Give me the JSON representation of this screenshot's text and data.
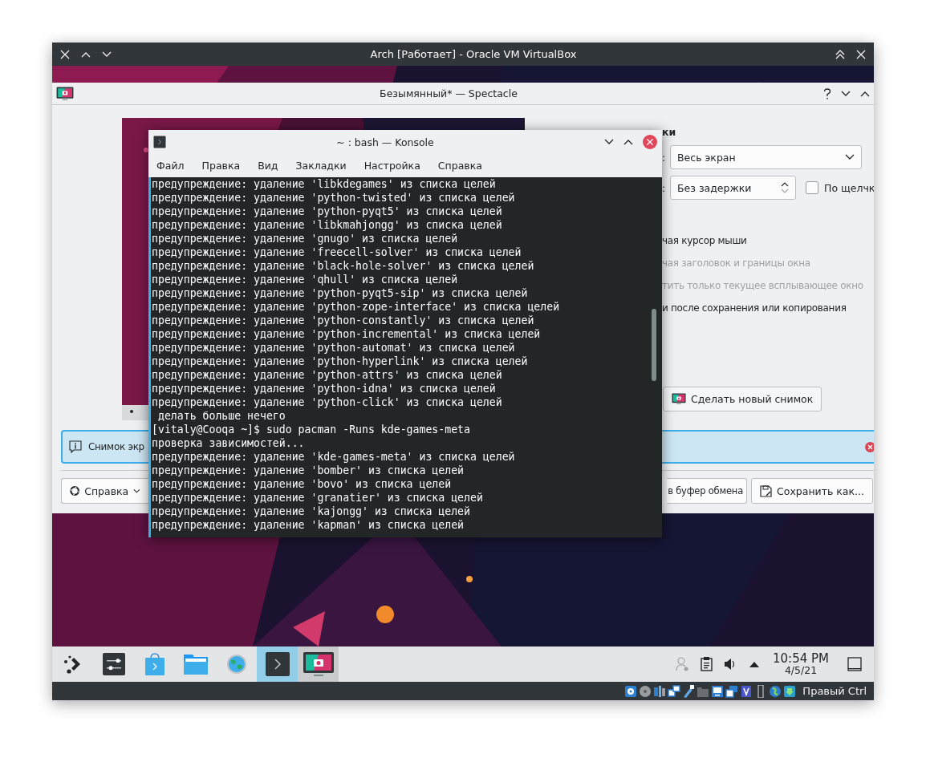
{
  "vm_window": {
    "title": "Arch [Работает] - Oracle VM VirtualBox",
    "status_bar": {
      "host_key": "Правый Ctrl"
    }
  },
  "spectacle": {
    "title": "Безымянный* — Spectacle",
    "heading": "ки",
    "fields": [
      {
        "label": ":",
        "value": "Весь экран",
        "kind": "combo"
      },
      {
        "label": ":",
        "value": "Без задержки",
        "kind": "spin"
      }
    ],
    "on_click": {
      "label": "По щелчк",
      "checked": false
    },
    "options": [
      {
        "label": "чая курсор мыши",
        "disabled": false
      },
      {
        "label": "чая заголовок и границы окна",
        "disabled": true
      },
      {
        "label": "тить только текущее всплывающее окно",
        "disabled": true
      },
      {
        "label": "и после сохранения или копирования",
        "disabled": false
      }
    ],
    "new_screenshot_button": "Сделать новый снимок",
    "message": "Снимок экр",
    "buttons": [
      {
        "label": "Справка",
        "kind": "help"
      },
      {
        "label": "в буфер обмена",
        "kind": "plain"
      },
      {
        "label": "Сохранить как...",
        "kind": "save"
      }
    ]
  },
  "konsole": {
    "title": "~ : bash — Konsole",
    "menu": [
      "Файл",
      "Правка",
      "Вид",
      "Закладки",
      "Настройка",
      "Справка"
    ],
    "lines": [
      "предупреждение: удаление 'libkdegames' из списка целей",
      "предупреждение: удаление 'python-twisted' из списка целей",
      "предупреждение: удаление 'python-pyqt5' из списка целей",
      "предупреждение: удаление 'libkmahjongg' из списка целей",
      "предупреждение: удаление 'gnugo' из списка целей",
      "предупреждение: удаление 'freecell-solver' из списка целей",
      "предупреждение: удаление 'black-hole-solver' из списка целей",
      "предупреждение: удаление 'qhull' из списка целей",
      "предупреждение: удаление 'python-pyqt5-sip' из списка целей",
      "предупреждение: удаление 'python-zope-interface' из списка целей",
      "предупреждение: удаление 'python-constantly' из списка целей",
      "предупреждение: удаление 'python-incremental' из списка целей",
      "предупреждение: удаление 'python-automat' из списка целей",
      "предупреждение: удаление 'python-hyperlink' из списка целей",
      "предупреждение: удаление 'python-attrs' из списка целей",
      "предупреждение: удаление 'python-idna' из списка целей",
      "предупреждение: удаление 'python-click' из списка целей",
      " делать больше нечего",
      "[vitaly@Cooqa ~]$ sudo pacman -Runs kde-games-meta",
      "проверка зависимостей...",
      "предупреждение: удаление 'kde-games-meta' из списка целей",
      "предупреждение: удаление 'bomber' из списка целей",
      "предупреждение: удаление 'bovo' из списка целей",
      "предупреждение: удаление 'granatier' из списка целей",
      "предупреждение: удаление 'kajongg' из списка целей",
      "предупреждение: удаление 'kapman' из списка целей"
    ]
  },
  "taskbar": {
    "tasks": [
      {
        "kind": "launcher",
        "selected": false,
        "open": false
      },
      {
        "kind": "settings",
        "selected": false,
        "open": false
      },
      {
        "kind": "store",
        "selected": false,
        "open": false
      },
      {
        "kind": "folder",
        "selected": false,
        "open": false
      },
      {
        "kind": "globe",
        "selected": false,
        "open": false
      },
      {
        "kind": "terminal",
        "selected": true,
        "open": true
      },
      {
        "kind": "screenshot",
        "selected": false,
        "open": true
      }
    ],
    "tray": [
      {
        "kind": "user",
        "disabled": true
      },
      {
        "kind": "clipboard",
        "disabled": false
      },
      {
        "kind": "volume",
        "disabled": false
      },
      {
        "kind": "expand",
        "disabled": false
      }
    ],
    "clock": {
      "time": "10:54 PM",
      "date": "4/5/21"
    }
  }
}
